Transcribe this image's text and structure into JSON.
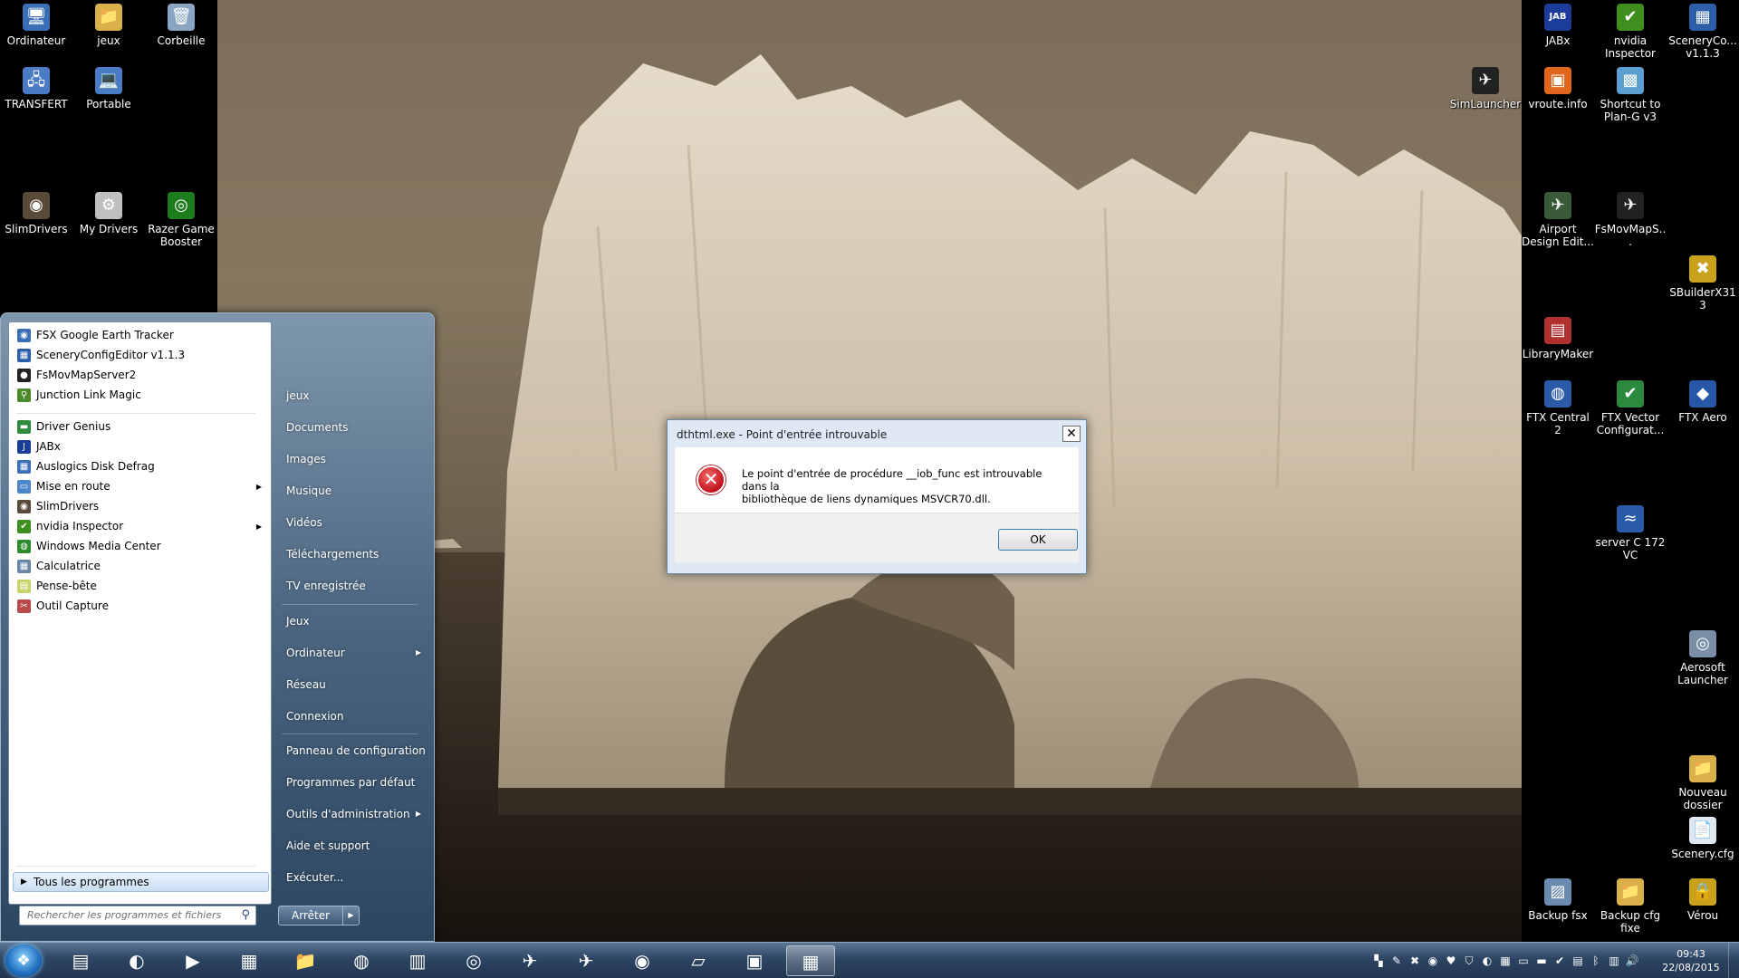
{
  "desktop": {
    "icons_left": [
      {
        "label": "Ordinateur",
        "icon": "computer-icon",
        "glyph": "🖥",
        "color": "#3a6fb5"
      },
      {
        "label": "jeux",
        "icon": "folder-icon",
        "glyph": "📁",
        "color": "#d9b04a"
      },
      {
        "label": "Corbeille",
        "icon": "recycle-bin-icon",
        "glyph": "🗑",
        "color": "#8aa5c2"
      },
      {
        "label": "TRANSFERT",
        "icon": "network-computer-icon",
        "glyph": "🖧",
        "color": "#4b7bc4"
      },
      {
        "label": "Portable",
        "icon": "laptop-icon",
        "glyph": "💻",
        "color": "#4b7bc4"
      },
      {
        "label": "SlimDrivers",
        "icon": "slimdrivers-icon",
        "glyph": "◉",
        "color": "#5a4a3a"
      },
      {
        "label": "My Drivers",
        "icon": "my-drivers-icon",
        "glyph": "⚙",
        "color": "#c0c0c0"
      },
      {
        "label": "Razer Game Booster",
        "icon": "razer-icon",
        "glyph": "◎",
        "color": "#1d7d1d"
      }
    ],
    "icons_right": [
      {
        "label": "JABx",
        "icon": "jabx-icon",
        "glyph": "JAB",
        "color": "#1c3c9c"
      },
      {
        "label": "nvidia Inspector",
        "icon": "nvidia-icon",
        "glyph": "✔",
        "color": "#3f8f1f"
      },
      {
        "label": "SceneryCo... v1.1.3",
        "icon": "scenery-config-icon",
        "glyph": "▦",
        "color": "#2d5fa8"
      },
      {
        "label": "SimLauncher",
        "icon": "plane-icon",
        "glyph": "✈",
        "color": "#222222"
      },
      {
        "label": "vroute.info",
        "icon": "vroute-icon",
        "glyph": "▣",
        "color": "#e2661d"
      },
      {
        "label": "Shortcut to Plan-G v3",
        "icon": "plan-g-icon",
        "glyph": "▩",
        "color": "#5a9fcf"
      },
      {
        "label": "Airport Design Edit...",
        "icon": "airport-design-icon",
        "glyph": "✈",
        "color": "#3a5a3a"
      },
      {
        "label": "FsMovMapS...",
        "icon": "fsmovmap-icon",
        "glyph": "✈",
        "color": "#222222"
      },
      {
        "label": "SBuilderX313",
        "icon": "sbuilder-icon",
        "glyph": "✖",
        "color": "#c9a21d"
      },
      {
        "label": "LibraryMaker",
        "icon": "library-maker-icon",
        "glyph": "▤",
        "color": "#b03030"
      },
      {
        "label": "FTX Central 2",
        "icon": "ftx-central-icon",
        "glyph": "◍",
        "color": "#2a5aa8"
      },
      {
        "label": "FTX Vector Configurat...",
        "icon": "ftx-vector-icon",
        "glyph": "✔",
        "color": "#2b8a3d"
      },
      {
        "label": "FTX Aero",
        "icon": "ftx-aero-icon",
        "glyph": "◆",
        "color": "#2857a8"
      },
      {
        "label": "server C 172 VC",
        "icon": "server-icon",
        "glyph": "≈",
        "color": "#2a5aa8"
      },
      {
        "label": "Aerosoft Launcher",
        "icon": "aerosoft-icon",
        "glyph": "◎",
        "color": "#7a8ea6"
      },
      {
        "label": "Nouveau dossier",
        "icon": "folder-icon",
        "glyph": "📁",
        "color": "#d9b04a"
      },
      {
        "label": "Scenery.cfg",
        "icon": "file-icon",
        "glyph": "📄",
        "color": "#dfe8f2"
      },
      {
        "label": "Backup fsx",
        "icon": "backup-icon",
        "glyph": "▨",
        "color": "#6a8ab0"
      },
      {
        "label": "Backup cfg fixe",
        "icon": "folder-icon",
        "glyph": "📁",
        "color": "#d9b04a"
      },
      {
        "label": "Vérou",
        "icon": "lock-icon",
        "glyph": "🔒",
        "color": "#c9a21d"
      }
    ]
  },
  "start_menu": {
    "programs": [
      {
        "label": "FSX Google Earth Tracker",
        "icon": "ge-tracker-icon",
        "color": "#3a6fb5",
        "glyph": "◉",
        "has_submenu": false
      },
      {
        "label": "SceneryConfigEditor v1.1.3",
        "icon": "scenery-config-icon",
        "color": "#2d5fa8",
        "glyph": "▦",
        "has_submenu": false
      },
      {
        "label": "FsMovMapServer2",
        "icon": "fsmovmap-icon",
        "color": "#222222",
        "glyph": "●",
        "has_submenu": false
      },
      {
        "label": "Junction Link Magic",
        "icon": "junction-icon",
        "color": "#4a8a2a",
        "glyph": "⚲",
        "has_submenu": false
      },
      {
        "label": "Driver Genius",
        "icon": "driver-genius-icon",
        "color": "#2f8a3d",
        "glyph": "▬",
        "has_submenu": false
      },
      {
        "label": "JABx",
        "icon": "jabx-icon",
        "color": "#1c3c9c",
        "glyph": "J",
        "has_submenu": false
      },
      {
        "label": "Auslogics Disk Defrag",
        "icon": "defrag-icon",
        "color": "#3b6eb8",
        "glyph": "▦",
        "has_submenu": false
      },
      {
        "label": "Mise en route",
        "icon": "getting-started-icon",
        "color": "#4b86c9",
        "glyph": "▭",
        "has_submenu": true
      },
      {
        "label": "SlimDrivers",
        "icon": "slimdrivers-icon",
        "color": "#5a4a3a",
        "glyph": "◉",
        "has_submenu": false
      },
      {
        "label": "nvidia Inspector",
        "icon": "nvidia-icon",
        "color": "#3f8f1f",
        "glyph": "✔",
        "has_submenu": true
      },
      {
        "label": "Windows Media Center",
        "icon": "media-center-icon",
        "color": "#2d8a2d",
        "glyph": "◍",
        "has_submenu": false
      },
      {
        "label": "Calculatrice",
        "icon": "calculator-icon",
        "color": "#6b87a8",
        "glyph": "▦",
        "has_submenu": false
      },
      {
        "label": "Pense-bête",
        "icon": "sticky-notes-icon",
        "color": "#c9d36a",
        "glyph": "▤",
        "has_submenu": false
      },
      {
        "label": "Outil Capture",
        "icon": "snipping-tool-icon",
        "color": "#b84a4a",
        "glyph": "✂",
        "has_submenu": false
      }
    ],
    "all_programs": "Tous les programmes",
    "search_placeholder": "Rechercher les programmes et fichiers",
    "right_items": [
      {
        "label": "jeux",
        "has_submenu": false
      },
      {
        "label": "Documents",
        "has_submenu": false
      },
      {
        "label": "Images",
        "has_submenu": false
      },
      {
        "label": "Musique",
        "has_submenu": false
      },
      {
        "label": "Vidéos",
        "has_submenu": false
      },
      {
        "label": "Téléchargements",
        "has_submenu": false
      },
      {
        "label": "TV enregistrée",
        "has_submenu": false
      },
      {
        "label": "Jeux",
        "has_submenu": false
      },
      {
        "label": "Ordinateur",
        "has_submenu": true
      },
      {
        "label": "Réseau",
        "has_submenu": false
      },
      {
        "label": "Connexion",
        "has_submenu": false
      },
      {
        "label": "Panneau de configuration",
        "has_submenu": false
      },
      {
        "label": "Programmes par défaut",
        "has_submenu": false
      },
      {
        "label": "Outils d'administration",
        "has_submenu": true
      },
      {
        "label": "Aide et support",
        "has_submenu": false
      },
      {
        "label": "Exécuter...",
        "has_submenu": false
      }
    ],
    "shutdown_label": "Arrêter"
  },
  "dialog": {
    "title": "dthtml.exe - Point d'entrée introuvable",
    "message_line1": "Le point d'entrée de procédure __iob_func est introuvable dans la",
    "message_line2": "bibliothèque de liens dynamiques MSVCR70.dll.",
    "ok_label": "OK",
    "close_glyph": "✕"
  },
  "taskbar": {
    "pinned": [
      {
        "icon": "task-manager-icon",
        "glyph": "▤"
      },
      {
        "icon": "media-player-icon",
        "glyph": "◐"
      },
      {
        "icon": "play-icon",
        "glyph": "▶"
      },
      {
        "icon": "explorer-window-icon",
        "glyph": "▦"
      },
      {
        "icon": "folder-icon",
        "glyph": "📁"
      },
      {
        "icon": "globe-icon",
        "glyph": "◍"
      },
      {
        "icon": "calculator-icon",
        "glyph": "▥"
      },
      {
        "icon": "disc-icon",
        "glyph": "◎"
      },
      {
        "icon": "plane-icon",
        "glyph": "✈"
      },
      {
        "icon": "jet-icon",
        "glyph": "✈"
      },
      {
        "icon": "earth-icon",
        "glyph": "◉"
      },
      {
        "icon": "notepad-icon",
        "glyph": "▱"
      },
      {
        "icon": "monitor-icon",
        "glyph": "▣"
      },
      {
        "icon": "application-window-icon",
        "glyph": "▦"
      }
    ],
    "tray": [
      {
        "icon": "tray-app-1-icon",
        "glyph": "▚"
      },
      {
        "icon": "tray-app-2-icon",
        "glyph": "✎"
      },
      {
        "icon": "tray-app-3-icon",
        "glyph": "✖"
      },
      {
        "icon": "tray-app-4-icon",
        "glyph": "◉"
      },
      {
        "icon": "tray-app-5-icon",
        "glyph": "♥"
      },
      {
        "icon": "tray-shield-icon",
        "glyph": "⛉"
      },
      {
        "icon": "tray-app-7-icon",
        "glyph": "◐"
      },
      {
        "icon": "tray-app-8-icon",
        "glyph": "▦"
      },
      {
        "icon": "tray-app-9-icon",
        "glyph": "▭"
      },
      {
        "icon": "tray-app-10-icon",
        "glyph": "▬"
      },
      {
        "icon": "tray-app-11-icon",
        "glyph": "✔"
      },
      {
        "icon": "tray-app-12-icon",
        "glyph": "▤"
      },
      {
        "icon": "bluetooth-icon",
        "glyph": "ᛒ"
      },
      {
        "icon": "network-icon",
        "glyph": "▥"
      },
      {
        "icon": "volume-icon",
        "glyph": "🔊"
      }
    ],
    "clock_time": "09:43",
    "clock_date": "22/08/2015"
  }
}
